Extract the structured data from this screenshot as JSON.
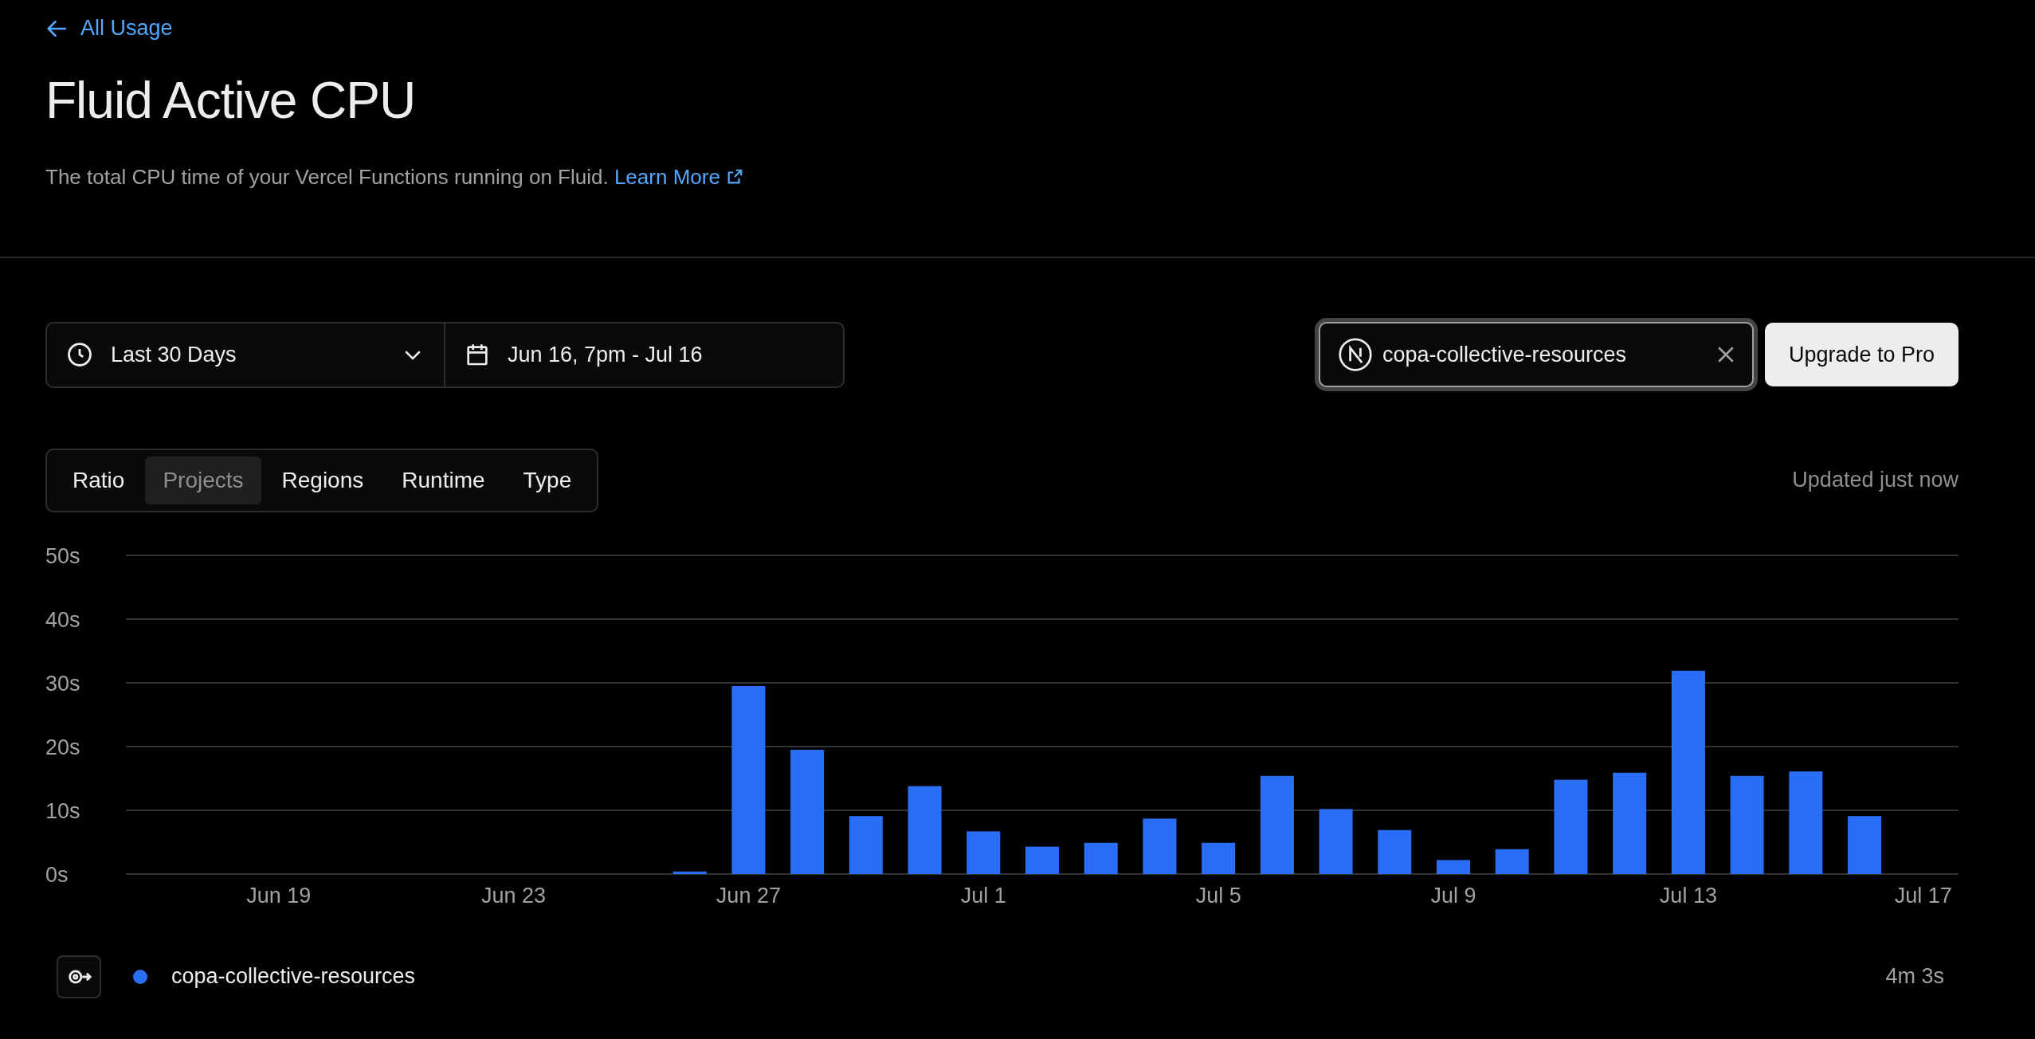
{
  "back_link": {
    "label": "All Usage"
  },
  "title": "Fluid Active CPU",
  "description": {
    "text": "The total CPU time of your Vercel Functions running on Fluid.",
    "link": "Learn More"
  },
  "filters": {
    "period": "Last 30 Days",
    "date_range": "Jun 16, 7pm - Jul 16"
  },
  "project_filter": {
    "value": "copa-collective-resources"
  },
  "upgrade_button": "Upgrade to Pro",
  "tabs": [
    {
      "label": "Ratio",
      "selected": false
    },
    {
      "label": "Projects",
      "selected": true
    },
    {
      "label": "Regions",
      "selected": false
    },
    {
      "label": "Runtime",
      "selected": false
    },
    {
      "label": "Type",
      "selected": false
    }
  ],
  "updated": "Updated just now",
  "chart_data": {
    "type": "bar",
    "categories": [
      null,
      null,
      null,
      "Jun 19",
      null,
      null,
      null,
      "Jun 23",
      null,
      null,
      null,
      "Jun 27",
      null,
      null,
      null,
      "Jul 1",
      null,
      null,
      null,
      "Jul 5",
      null,
      null,
      null,
      "Jul 9",
      null,
      null,
      null,
      "Jul 13",
      null,
      null,
      null,
      "Jul 17"
    ],
    "series": [
      {
        "name": "copa-collective-resources",
        "color": "#2a6ef5",
        "values": [
          null,
          null,
          null,
          null,
          null,
          null,
          null,
          null,
          null,
          null,
          0.4,
          29.5,
          19.5,
          9.1,
          13.8,
          6.7,
          4.3,
          4.9,
          8.7,
          4.9,
          15.4,
          10.2,
          6.9,
          2.2,
          3.9,
          14.8,
          15.9,
          31.9,
          15.4,
          16.1,
          9.1,
          null
        ]
      }
    ],
    "ylim": [
      0,
      50
    ],
    "grid": true,
    "yticks": [
      {
        "value": 0,
        "label": "0s"
      },
      {
        "value": 10,
        "label": "10s"
      },
      {
        "value": 20,
        "label": "20s"
      },
      {
        "value": 30,
        "label": "30s"
      },
      {
        "value": 40,
        "label": "40s"
      },
      {
        "value": 50,
        "label": "50s"
      }
    ]
  },
  "legend_totals": [
    "4m 3s"
  ]
}
